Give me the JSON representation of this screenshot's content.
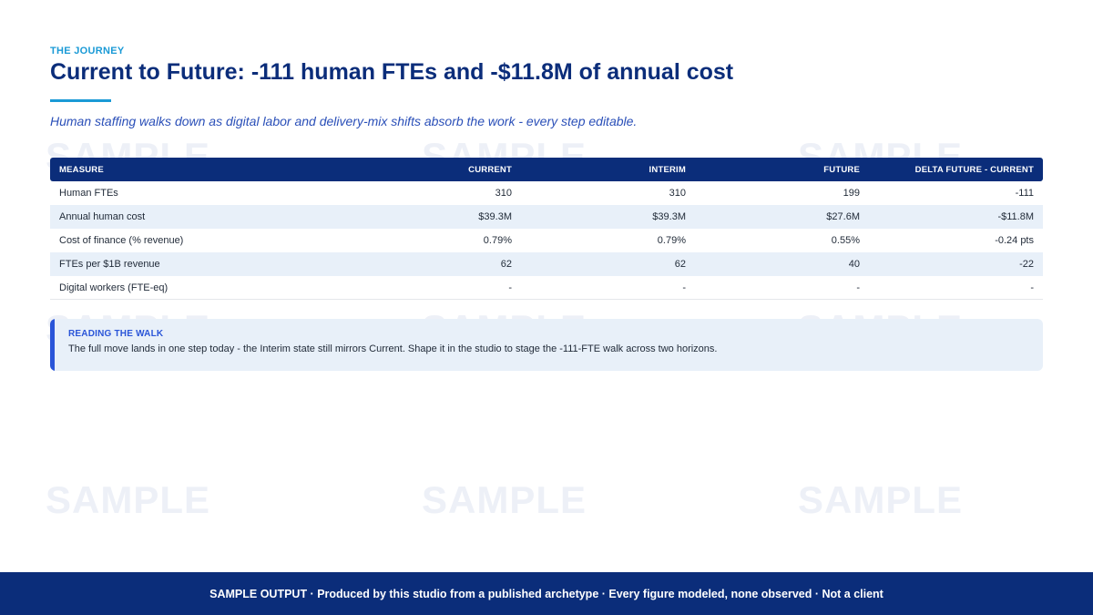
{
  "eyebrow": "THE JOURNEY",
  "title": "Current to Future: -111 human FTEs and -$11.8M of annual cost",
  "subtitle": "Human staffing walks down as digital labor and delivery-mix shifts absorb the work - every step editable.",
  "watermark": "SAMPLE",
  "table": {
    "headers": [
      "MEASURE",
      "CURRENT",
      "INTERIM",
      "FUTURE",
      "DELTA FUTURE - CURRENT"
    ],
    "rows": [
      [
        "Human FTEs",
        "310",
        "310",
        "199",
        "-111"
      ],
      [
        "Annual human cost",
        "$39.3M",
        "$39.3M",
        "$27.6M",
        "-$11.8M"
      ],
      [
        "Cost of finance (% revenue)",
        "0.79%",
        "0.79%",
        "0.55%",
        "-0.24 pts"
      ],
      [
        "FTEs per $1B revenue",
        "62",
        "62",
        "40",
        "-22"
      ],
      [
        "Digital workers (FTE-eq)",
        "-",
        "-",
        "-",
        "-"
      ]
    ]
  },
  "callout": {
    "label": "READING THE WALK",
    "text": "The full move lands in one step today - the Interim state still mirrors Current. Shape it in the studio to stage the -111-FTE walk across two horizons."
  },
  "footer": "SAMPLE OUTPUT  ·  Produced by this studio from a published archetype  ·  Every figure modeled, none observed  ·  Not a client",
  "colors": {
    "navy": "#0b2d7a",
    "accent_cyan": "#1a9ad6",
    "accent_blue": "#2a55d8",
    "row_alt": "#e8f0f9"
  }
}
